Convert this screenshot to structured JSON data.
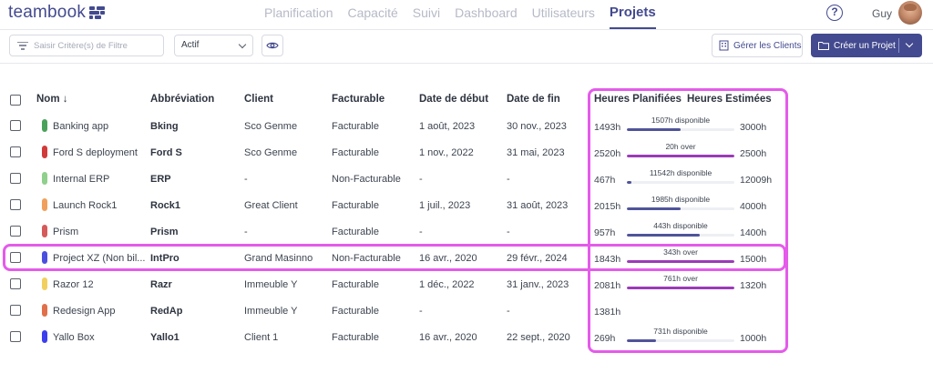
{
  "app": {
    "logo": "teambook",
    "nav": [
      "Planification",
      "Capacité",
      "Suivi",
      "Dashboard",
      "Utilisateurs",
      "Projets"
    ],
    "active_nav": "Projets",
    "help_label": "?",
    "user_name": "Guy"
  },
  "toolbar": {
    "filter_placeholder": "Saisir Critère(s) de Filtre",
    "status_value": "Actif",
    "manage_clients_label": "Gérer les Clients",
    "create_project_label": "Créer un Projet"
  },
  "table": {
    "headers": {
      "name": "Nom ↓",
      "abbreviation": "Abbréviation",
      "client": "Client",
      "billable": "Facturable",
      "start": "Date de début",
      "end": "Date de fin",
      "planned": "Heures Planifiées",
      "estimated": "Heures Estimées"
    },
    "rows": [
      {
        "name": "Banking app",
        "color": "#4aa25a",
        "abbr": "Bking",
        "client": "Sco Genme",
        "billable": "Facturable",
        "start": "1 août, 2023",
        "end": "30 nov., 2023",
        "planned": "1493h",
        "bar_label": "1507h disponible",
        "bar_fill": 0.5,
        "bar_color": "#4f5499",
        "estimated": "3000h"
      },
      {
        "name": "Ford S deployment",
        "color": "#d23a3a",
        "abbr": "Ford S",
        "client": "Sco Genme",
        "billable": "Facturable",
        "start": "1 nov., 2022",
        "end": "31 mai, 2023",
        "planned": "2520h",
        "bar_label": "20h over",
        "bar_fill": 1,
        "bar_color": "#9b3bb8",
        "estimated": "2500h"
      },
      {
        "name": "Internal ERP",
        "color": "#8fd08c",
        "abbr": "ERP",
        "client": "-",
        "billable": "Non-Facturable",
        "start": "-",
        "end": "-",
        "planned": "467h",
        "bar_label": "11542h disponible",
        "bar_fill": 0.04,
        "bar_color": "#4f5499",
        "estimated": "12009h"
      },
      {
        "name": "Launch Rock1",
        "color": "#f0a05a",
        "abbr": "Rock1",
        "client": "Great Client",
        "billable": "Facturable",
        "start": "1 juil., 2023",
        "end": "31 août, 2023",
        "planned": "2015h",
        "bar_label": "1985h disponible",
        "bar_fill": 0.5,
        "bar_color": "#4f5499",
        "estimated": "4000h"
      },
      {
        "name": "Prism",
        "color": "#d55a5a",
        "abbr": "Prism",
        "client": "-",
        "billable": "Facturable",
        "start": "-",
        "end": "-",
        "planned": "957h",
        "bar_label": "443h disponible",
        "bar_fill": 0.68,
        "bar_color": "#4f5499",
        "estimated": "1400h"
      },
      {
        "name": "Project XZ (Non bil...",
        "color": "#4b4fe0",
        "abbr": "IntPro",
        "client": "Grand Masinno",
        "billable": "Non-Facturable",
        "start": "16 avr., 2020",
        "end": "29 févr., 2024",
        "planned": "1843h",
        "bar_label": "343h over",
        "bar_fill": 1,
        "bar_color": "#9b3bb8",
        "estimated": "1500h"
      },
      {
        "name": "Razor 12",
        "color": "#f2d060",
        "abbr": "Razr",
        "client": "Immeuble Y",
        "billable": "Facturable",
        "start": "1 déc., 2022",
        "end": "31 janv., 2023",
        "planned": "2081h",
        "bar_label": "761h over",
        "bar_fill": 1,
        "bar_color": "#9b3bb8",
        "estimated": "1320h"
      },
      {
        "name": "Redesign App",
        "color": "#e0704a",
        "abbr": "RedAp",
        "client": "Immeuble Y",
        "billable": "Facturable",
        "start": "-",
        "end": "-",
        "planned": "1381h",
        "bar_label": "",
        "bar_fill": 0,
        "bar_color": "#4f5499",
        "estimated": ""
      },
      {
        "name": "Yallo Box",
        "color": "#3b3ff0",
        "abbr": "Yallo1",
        "client": "Client 1",
        "billable": "Facturable",
        "start": "16 avr., 2020",
        "end": "22 sept., 2020",
        "planned": "269h",
        "bar_label": "731h disponible",
        "bar_fill": 0.27,
        "bar_color": "#4f5499",
        "estimated": "1000h"
      }
    ]
  },
  "colors": {
    "brand": "#434a8f",
    "highlight": "#e45bea",
    "over": "#9b3bb8",
    "available": "#4f5499"
  }
}
